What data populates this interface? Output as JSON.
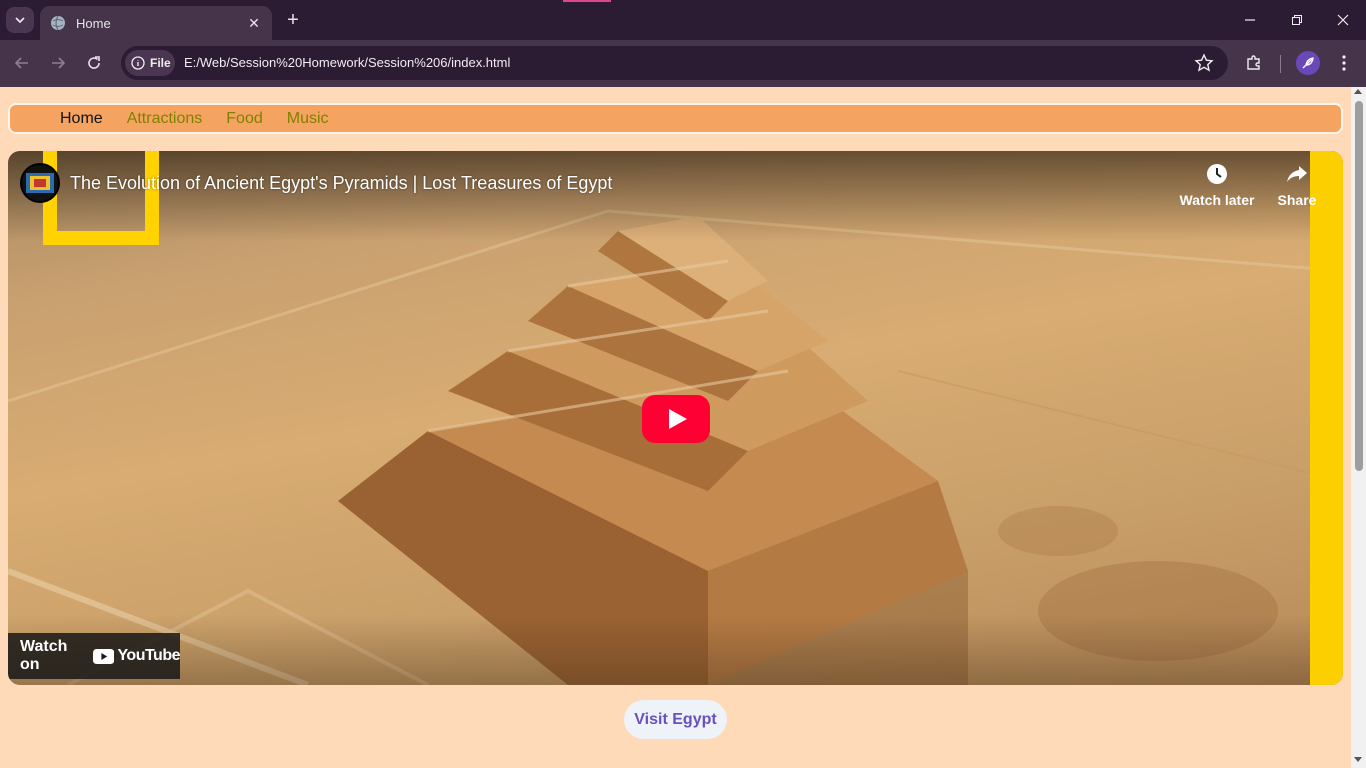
{
  "browser": {
    "tab_title": "Home",
    "new_tab_label": "+",
    "site_info_label": "File",
    "url": "E:/Web/Session%20Homework/Session%206/index.html"
  },
  "nav": {
    "items": [
      {
        "label": "Home",
        "active": true
      },
      {
        "label": "Attractions",
        "active": false
      },
      {
        "label": "Food",
        "active": false
      },
      {
        "label": "Music",
        "active": false
      }
    ]
  },
  "video": {
    "title": "The Evolution of Ancient Egypt's Pyramids | Lost Treasures of Egypt",
    "watch_later_label": "Watch later",
    "share_label": "Share",
    "watch_on_label": "Watch on",
    "youtube_label": "YouTube"
  },
  "cta": {
    "visit_label": "Visit Egypt"
  },
  "colors": {
    "page_bg": "#ffdab9",
    "navbar_bg": "#f4a460",
    "nav_link": "#808000",
    "youtube_red": "#ff0033",
    "natgeo_yellow": "#ffd200"
  }
}
